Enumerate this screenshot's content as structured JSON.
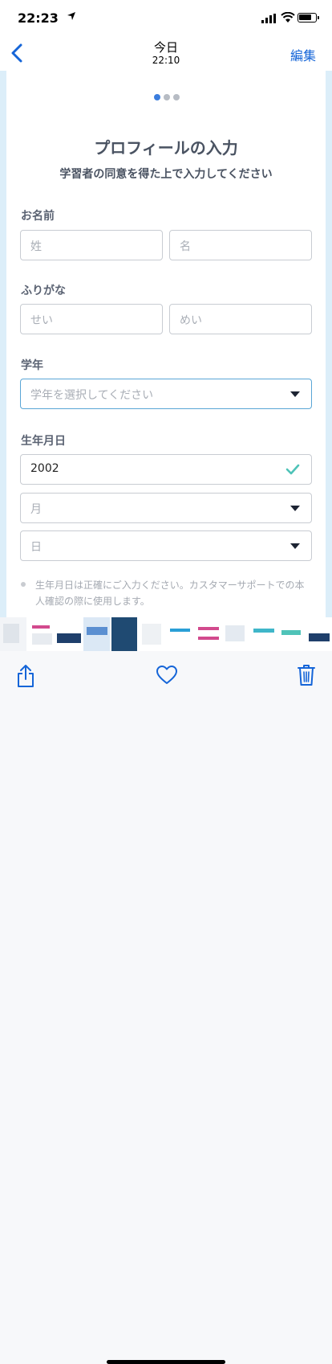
{
  "status_bar": {
    "time": "22:23"
  },
  "nav": {
    "title": "今日",
    "subtitle": "22:10",
    "edit": "編集"
  },
  "form": {
    "title": "プロフィールの入力",
    "subtitle": "学習者の同意を得た上で入力してください",
    "name_label": "お名前",
    "last_name_placeholder": "姓",
    "first_name_placeholder": "名",
    "furigana_label": "ふりがな",
    "sei_placeholder": "せい",
    "mei_placeholder": "めい",
    "grade_label": "学年",
    "grade_placeholder": "学年を選択してください",
    "birthday_label": "生年月日",
    "year_value": "2002",
    "month_placeholder": "月",
    "day_placeholder": "日",
    "note": "生年月日は正確にご入力ください。カスタマーサポートでの本人確認の際に使用します。"
  },
  "colors": {
    "accent": "#1565d8",
    "check": "#4fc3b8",
    "label": "#5a6272"
  },
  "toolbar": {
    "share_icon": "share-icon",
    "favorite_icon": "heart-icon",
    "delete_icon": "trash-icon"
  }
}
